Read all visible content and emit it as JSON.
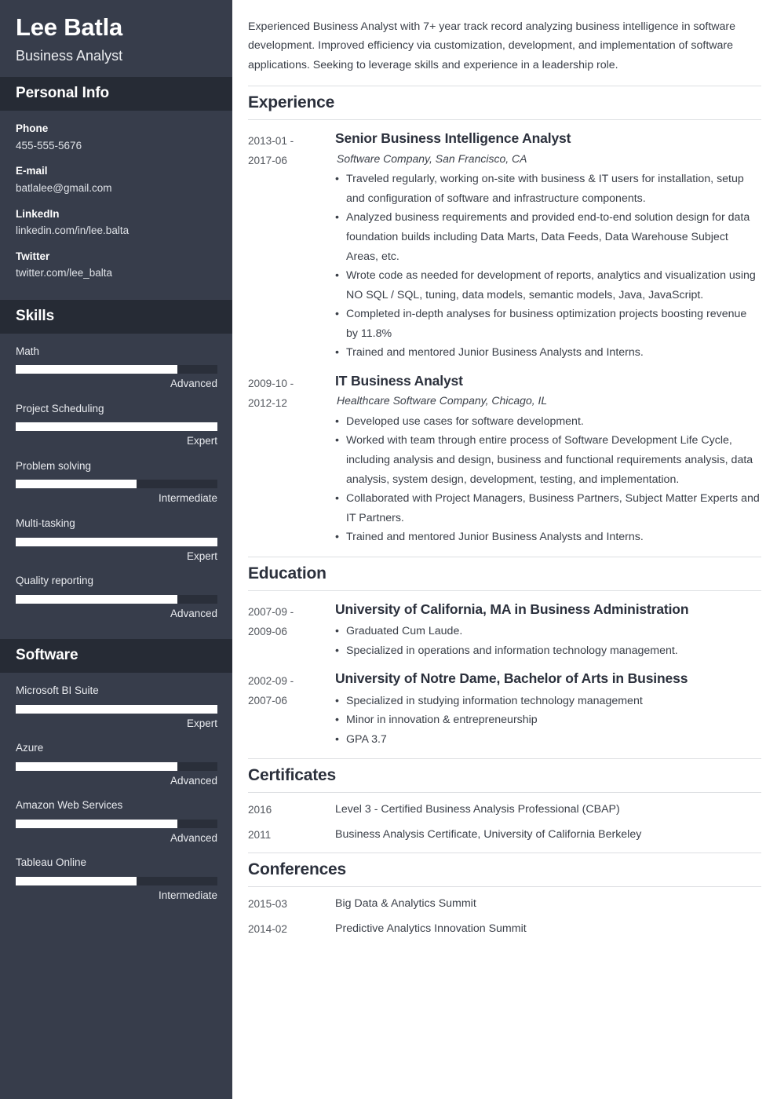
{
  "sidebar": {
    "full_name": "Lee Batla",
    "job_title": "Business Analyst",
    "personal_info": {
      "heading": "Personal Info",
      "items": [
        {
          "label": "Phone",
          "value": "455-555-5676"
        },
        {
          "label": "E-mail",
          "value": "batlalee@gmail.com"
        },
        {
          "label": "LinkedIn",
          "value": "linkedin.com/in/lee.balta"
        },
        {
          "label": "Twitter",
          "value": "twitter.com/lee_balta"
        }
      ]
    },
    "skills": {
      "heading": "Skills",
      "items": [
        {
          "name": "Math",
          "level": "Advanced",
          "percent": 80
        },
        {
          "name": "Project Scheduling",
          "level": "Expert",
          "percent": 100
        },
        {
          "name": "Problem solving",
          "level": "Intermediate",
          "percent": 60
        },
        {
          "name": "Multi-tasking",
          "level": "Expert",
          "percent": 100
        },
        {
          "name": "Quality reporting",
          "level": "Advanced",
          "percent": 80
        }
      ]
    },
    "software": {
      "heading": "Software",
      "items": [
        {
          "name": "Microsoft BI Suite",
          "level": "Expert",
          "percent": 100
        },
        {
          "name": "Azure",
          "level": "Advanced",
          "percent": 80
        },
        {
          "name": "Amazon Web Services",
          "level": "Advanced",
          "percent": 80
        },
        {
          "name": "Tableau Online",
          "level": "Intermediate",
          "percent": 60
        }
      ]
    }
  },
  "main": {
    "summary": "Experienced Business Analyst with 7+ year track record analyzing business intelligence in software development. Improved efficiency via customization, development, and implementation of software applications. Seeking to leverage skills and experience in a leadership role.",
    "experience": {
      "heading": "Experience",
      "entries": [
        {
          "date": "2013-01 -\n2017-06",
          "date_start": "2013-01 -",
          "date_end": "2017-06",
          "title": "Senior Business Intelligence Analyst",
          "subtitle": "Software Company, San Francisco, CA",
          "bullets": [
            "Traveled regularly, working on-site with business & IT users for installation, setup and configuration of software and infrastructure components.",
            "Analyzed business requirements and provided end-to-end solution design for data foundation builds including Data Marts, Data Feeds, Data Warehouse Subject Areas, etc.",
            "Wrote code as needed for development of reports, analytics and visualization using NO SQL / SQL, tuning, data models, semantic models, Java, JavaScript.",
            "Completed in-depth analyses for business optimization projects boosting revenue by 11.8%",
            "Trained and mentored Junior Business Analysts and Interns."
          ]
        },
        {
          "date_start": "2009-10 -",
          "date_end": "2012-12",
          "title": "IT Business Analyst",
          "subtitle": "Healthcare Software Company, Chicago, IL",
          "bullets": [
            "Developed use cases for software development.",
            "Worked with team through entire process of Software Development Life Cycle, including analysis and design, business and functional requirements analysis, data analysis, system design, development, testing, and implementation.",
            "Collaborated with Project Managers, Business Partners, Subject Matter Experts and IT Partners.",
            "Trained and mentored Junior Business Analysts and Interns."
          ]
        }
      ]
    },
    "education": {
      "heading": "Education",
      "entries": [
        {
          "date_start": "2007-09 -",
          "date_end": "2009-06",
          "title": "University of California, MA in Business Administration",
          "bullets": [
            "Graduated Cum Laude.",
            "Specialized in operations and information technology management."
          ]
        },
        {
          "date_start": "2002-09 -",
          "date_end": "2007-06",
          "title": "University of Notre Dame, Bachelor of Arts in Business",
          "bullets": [
            "Specialized in studying information technology management",
            "Minor in innovation & entrepreneurship",
            "GPA 3.7"
          ]
        }
      ]
    },
    "certificates": {
      "heading": "Certificates",
      "rows": [
        {
          "date": "2016",
          "text": "Level 3 - Certified Business Analysis Professional (CBAP)"
        },
        {
          "date": "2011",
          "text": "Business Analysis Certificate, University of California Berkeley"
        }
      ]
    },
    "conferences": {
      "heading": "Conferences",
      "rows": [
        {
          "date": "2015-03",
          "text": "Big Data & Analytics Summit"
        },
        {
          "date": "2014-02",
          "text": "Predictive Analytics Innovation Summit"
        }
      ]
    }
  }
}
